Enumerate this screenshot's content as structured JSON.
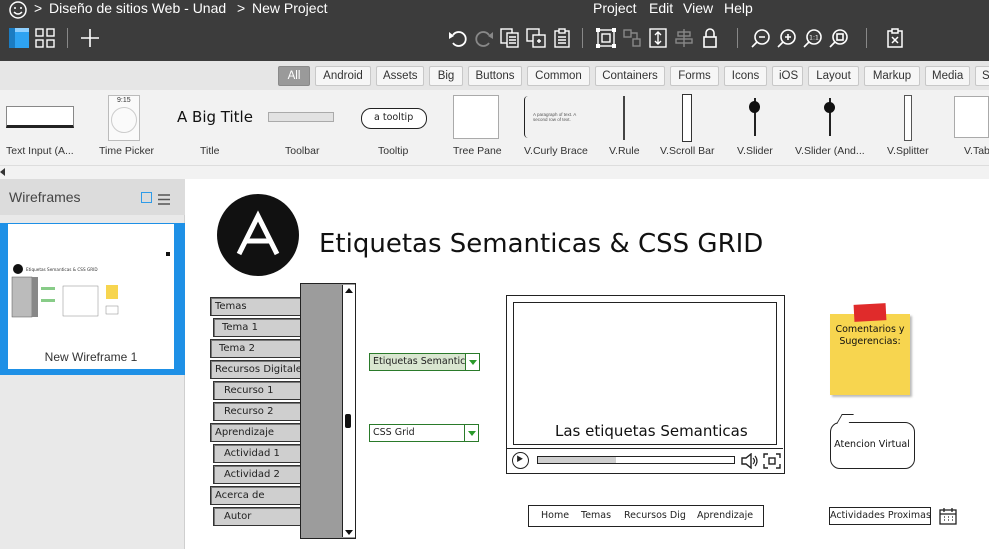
{
  "titlebar": {
    "breadcrumb_sep1": ">",
    "project_name": "Diseño de sitios Web - Unad",
    "breadcrumb_sep2": ">",
    "page_name": "New Project",
    "menus": [
      "Project",
      "Edit",
      "View",
      "Help"
    ]
  },
  "filters": [
    "All",
    "Android",
    "Assets",
    "Big",
    "Buttons",
    "Common",
    "Containers",
    "Forms",
    "Icons",
    "iOS",
    "Layout",
    "Markup",
    "Media",
    "S"
  ],
  "filter_active": "All",
  "library": [
    {
      "label": "Text Input (A..."
    },
    {
      "label": "Time Picker",
      "preview_text": "9:15"
    },
    {
      "label": "Title",
      "preview_text": "A Big Title"
    },
    {
      "label": "Toolbar"
    },
    {
      "label": "Tooltip",
      "preview_text": "a tooltip"
    },
    {
      "label": "Tree Pane"
    },
    {
      "label": "V.Curly Brace",
      "preview_text": "A paragraph of text. A second row of text."
    },
    {
      "label": "V.Rule"
    },
    {
      "label": "V.Scroll Bar"
    },
    {
      "label": "V.Slider"
    },
    {
      "label": "V.Slider (And..."
    },
    {
      "label": "V.Splitter"
    },
    {
      "label": "V.Tabs"
    }
  ],
  "leftpane": {
    "title": "Wireframes",
    "wireframe_name": "New Wireframe 1",
    "thumb_title": "Etiquetas Semanticas & CSS GRID"
  },
  "canvas": {
    "page_title": "Etiquetas Semanticas & CSS GRID",
    "nav_items": [
      "Temas",
      "Tema 1",
      "Tema 2",
      "Recursos Digitales",
      "Recurso 1",
      "Recurso 2",
      "Aprendizaje",
      "Actividad 1",
      "Actividad 2",
      "Acerca de",
      "Autor"
    ],
    "combo_semantic": "Etiquetas Semanticas",
    "combo_grid": "CSS Grid",
    "video_caption": "Las etiquetas Semanticas",
    "sticky_note": "Comentarios y Sugerencias:",
    "callout": "Atencion Virtual",
    "bottom_nav": [
      "Home",
      "Temas",
      "Recursos Dig",
      "Aprendizaje"
    ],
    "activities_button": "Actividades Proximas"
  },
  "colors": {
    "topbar": "#3c3c3c",
    "selection": "#1e90e6",
    "sticky": "#f7d54f",
    "green": "#2a9a2a"
  }
}
